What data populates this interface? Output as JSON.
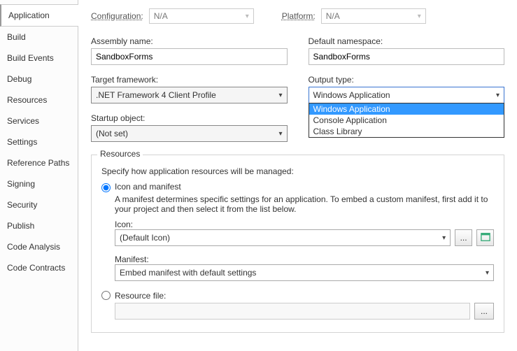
{
  "sidebar": {
    "items": [
      {
        "label": "Application"
      },
      {
        "label": "Build"
      },
      {
        "label": "Build Events"
      },
      {
        "label": "Debug"
      },
      {
        "label": "Resources"
      },
      {
        "label": "Services"
      },
      {
        "label": "Settings"
      },
      {
        "label": "Reference Paths"
      },
      {
        "label": "Signing"
      },
      {
        "label": "Security"
      },
      {
        "label": "Publish"
      },
      {
        "label": "Code Analysis"
      },
      {
        "label": "Code Contracts"
      }
    ],
    "active_index": 0
  },
  "header": {
    "configuration_label": "Configuration:",
    "configuration_value": "N/A",
    "platform_label": "Platform:",
    "platform_value": "N/A"
  },
  "fields": {
    "assembly_name_label": "Assembly name:",
    "assembly_name_value": "SandboxForms",
    "default_namespace_label": "Default namespace:",
    "default_namespace_value": "SandboxForms",
    "target_framework_label": "Target framework:",
    "target_framework_value": ".NET Framework 4 Client Profile",
    "output_type_label": "Output type:",
    "output_type_value": "Windows Application",
    "output_type_options": [
      "Windows Application",
      "Console Application",
      "Class Library"
    ],
    "startup_object_label": "Startup object:",
    "startup_object_value": "(Not set)"
  },
  "resources": {
    "group_title": "Resources",
    "group_desc": "Specify how application resources will be managed:",
    "icon_manifest_label": "Icon and manifest",
    "icon_manifest_desc": "A manifest determines specific settings for an application. To embed a custom manifest, first add it to your project and then select it from the list below.",
    "icon_label": "Icon:",
    "icon_value": "(Default Icon)",
    "browse_label": "...",
    "manifest_label": "Manifest:",
    "manifest_value": "Embed manifest with default settings",
    "resource_file_label": "Resource file:",
    "resource_file_browse": "..."
  }
}
